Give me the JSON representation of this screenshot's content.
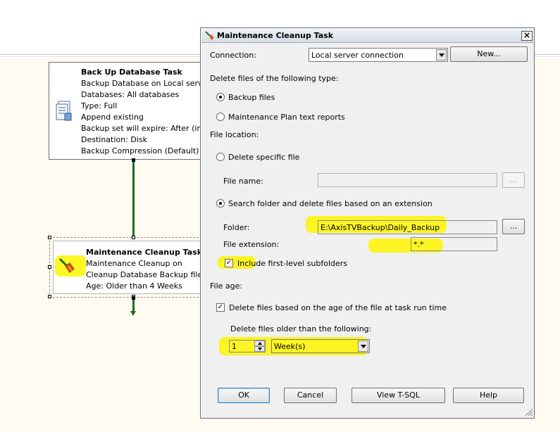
{
  "designer": {
    "backup_task": {
      "title": "Back Up Database Task",
      "lines": [
        "Backup Database on Local server c",
        "Databases: All databases",
        "Type: Full",
        "Append existing",
        "Backup set will expire: After (in day",
        "Destination: Disk",
        "Backup Compression (Default)"
      ]
    },
    "cleanup_task": {
      "title": "Maintenance Cleanup Task",
      "lines": [
        "Maintenance Cleanup on",
        "Cleanup Database Backup files",
        "Age: Older than 4 Weeks"
      ]
    }
  },
  "dialog": {
    "title": "Maintenance Cleanup Task",
    "connection_label": "Connection:",
    "connection_value": "Local server connection",
    "new_button": "New...",
    "delete_type_label": "Delete files of the following type:",
    "radio_backup_files": "Backup files",
    "radio_text_reports": "Maintenance Plan text reports",
    "file_location_label": "File location:",
    "radio_delete_specific": "Delete specific file",
    "file_name_label": "File name:",
    "file_name_value": "",
    "browse_label": "...",
    "radio_search_folder": "Search folder and delete files based on an extension",
    "folder_label": "Folder:",
    "folder_value": "E:\\AxisTVBackup\\Daily_Backup",
    "file_extension_label": "File extension:",
    "file_extension_value": "*.*",
    "include_subfolders_label": "Include first-level subfolders",
    "file_age_label": "File age:",
    "delete_by_age_label": "Delete files based on the age of the file at task run time",
    "delete_older_label": "Delete files older than the following:",
    "age_value": "1",
    "age_unit": "Week(s)",
    "ok_button": "OK",
    "cancel_button": "Cancel",
    "view_tsql_button": "View T-SQL",
    "help_button": "Help",
    "close_glyph": "×"
  },
  "colors": {
    "highlight": "#fff500",
    "connector": "#1e6f1e",
    "canvas": "#fffbf0"
  }
}
